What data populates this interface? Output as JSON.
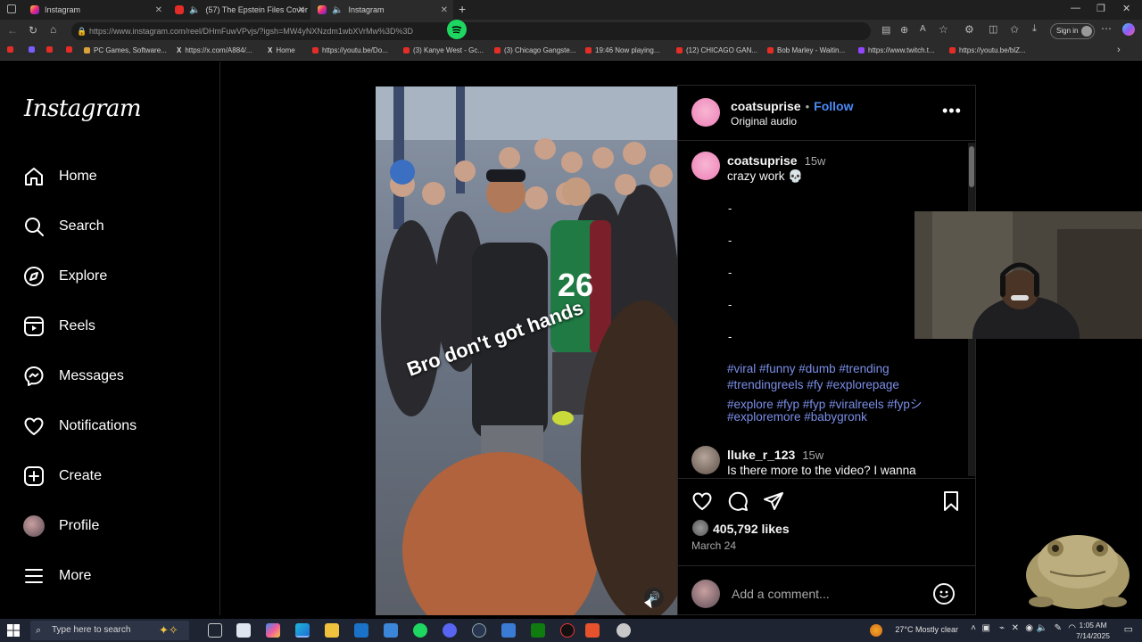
{
  "browser": {
    "tabs": [
      {
        "title": "Instagram",
        "icon": "instagram-icon"
      },
      {
        "title": "(57) The Epstein Files Cover",
        "icon": "youtube-icon"
      },
      {
        "title": "Instagram",
        "icon": "instagram-icon"
      }
    ],
    "url": "https://www.instagram.com/reel/DHmFuwVPvjs/?igsh=MW4yNXNzdm1wbXVrMw%3D%3D",
    "sign_in": "Sign in",
    "bookmarks": [
      "PC Games, Software...",
      "https://x.com/A884/...",
      "Home",
      "https://youtu.be/Do...",
      "(3) Kanye West - Gc...",
      "(3) Chicago Gangste...",
      "19:46 Now playing...",
      "(12) CHICAGO GAN...",
      "Bob Marley - Waitin...",
      "https://www.twitch.t...",
      "https://youtu.be/blZ..."
    ]
  },
  "sidebar": {
    "logo": "Instagram",
    "items": [
      {
        "label": "Home",
        "icon": "home-icon"
      },
      {
        "label": "Search",
        "icon": "search-icon"
      },
      {
        "label": "Explore",
        "icon": "compass-icon"
      },
      {
        "label": "Reels",
        "icon": "reels-icon"
      },
      {
        "label": "Messages",
        "icon": "messenger-icon"
      },
      {
        "label": "Notifications",
        "icon": "heart-icon"
      },
      {
        "label": "Create",
        "icon": "plus-square-icon"
      },
      {
        "label": "Profile",
        "icon": "avatar"
      },
      {
        "label": "More",
        "icon": "menu-icon"
      }
    ]
  },
  "post": {
    "overlay_text": "Bro don't got hands",
    "header": {
      "username": "coatsuprise",
      "separator": "•",
      "follow": "Follow",
      "audio": "Original audio"
    },
    "caption": {
      "username": "coatsuprise",
      "time": "15w",
      "text": "crazy work 💀",
      "dashes": [
        "-",
        "-",
        "-",
        "-",
        "-"
      ],
      "hashtags": [
        "#viral #funny #dumb #trending",
        "#trendingreels #fy #explorepage",
        "#explore #fyp #fyp #viralreels #fypシ",
        "#exploremore #babygronk"
      ]
    },
    "comment": {
      "username": "lluke_r_123",
      "time": "15w",
      "text": "Is there more to the video? I wanna"
    },
    "likes": "405,792 likes",
    "date": "March 24",
    "add_comment_placeholder": "Add a comment..."
  },
  "taskbar": {
    "search_placeholder": "Type here to search",
    "weather": "27°C  Mostly clear",
    "time": "1:05 AM",
    "date": "7/14/2025"
  },
  "colors": {
    "instagram_link": "#4a8cf7",
    "hashtag": "#7b8fe8",
    "spotify": "#1ed760"
  }
}
